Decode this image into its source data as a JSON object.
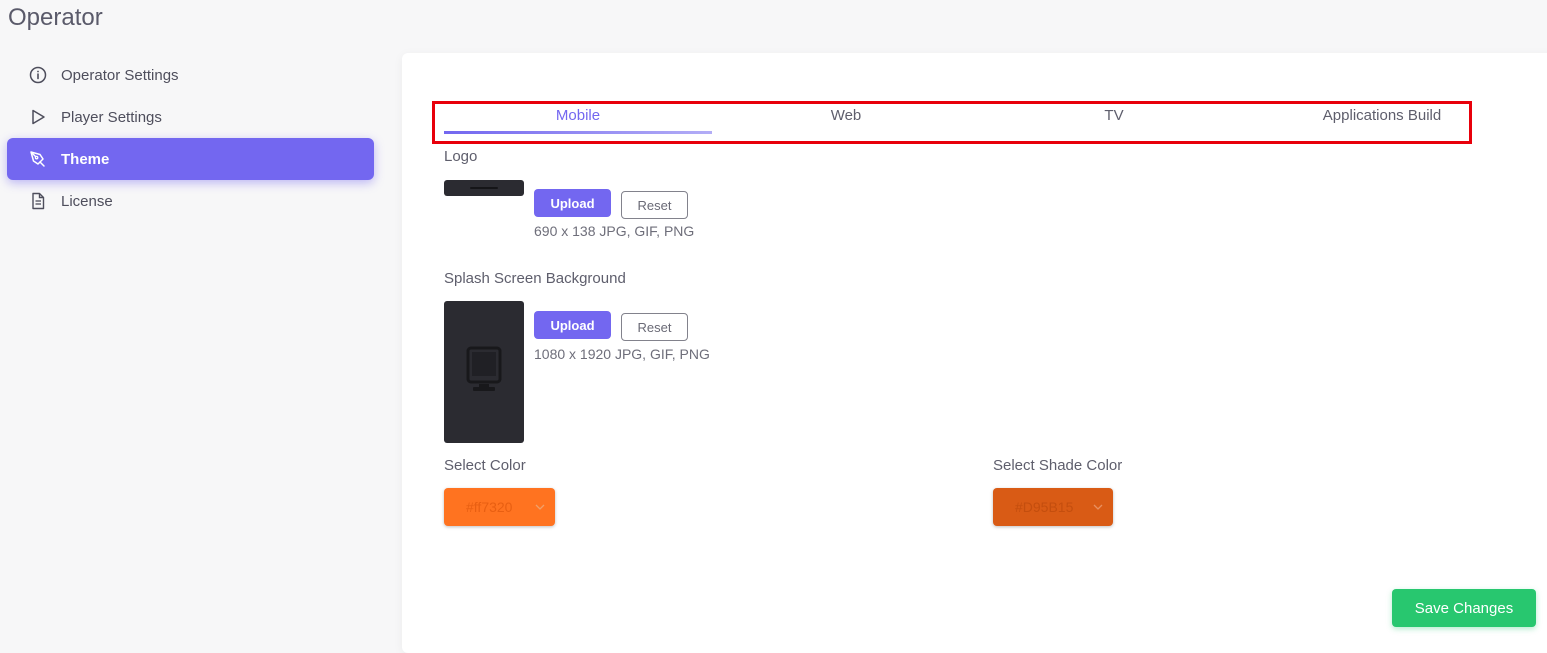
{
  "app": {
    "title": "Operator"
  },
  "sidebar": {
    "items": [
      {
        "label": "Operator Settings",
        "icon": "info-circle-icon"
      },
      {
        "label": "Player Settings",
        "icon": "play-icon"
      },
      {
        "label": "Theme",
        "icon": "pen-tool-icon",
        "active": true
      },
      {
        "label": "License",
        "icon": "file-text-icon"
      }
    ]
  },
  "tabs": [
    {
      "label": "Mobile",
      "active": true
    },
    {
      "label": "Web"
    },
    {
      "label": "TV"
    },
    {
      "label": "Applications Build"
    }
  ],
  "logo": {
    "label": "Logo",
    "upload_label": "Upload",
    "reset_label": "Reset",
    "hint": "690 x 138 JPG, GIF, PNG"
  },
  "splash": {
    "label": "Splash Screen Background",
    "upload_label": "Upload",
    "reset_label": "Reset",
    "hint": "1080 x 1920 JPG, GIF, PNG",
    "placeholder_icon": "device-icon"
  },
  "color": {
    "label": "Select Color",
    "value": "#ff7320",
    "swatch": "#ff7320",
    "text_color": "#e85f12"
  },
  "shade_color": {
    "label": "Select Shade Color",
    "value": "#D95B15",
    "swatch": "#d95b15",
    "text_color": "#c44e0e"
  },
  "actions": {
    "save_label": "Save Changes"
  },
  "colors": {
    "accent": "#7367f0",
    "success": "#28c76f",
    "highlight_frame": "#e8000b"
  }
}
